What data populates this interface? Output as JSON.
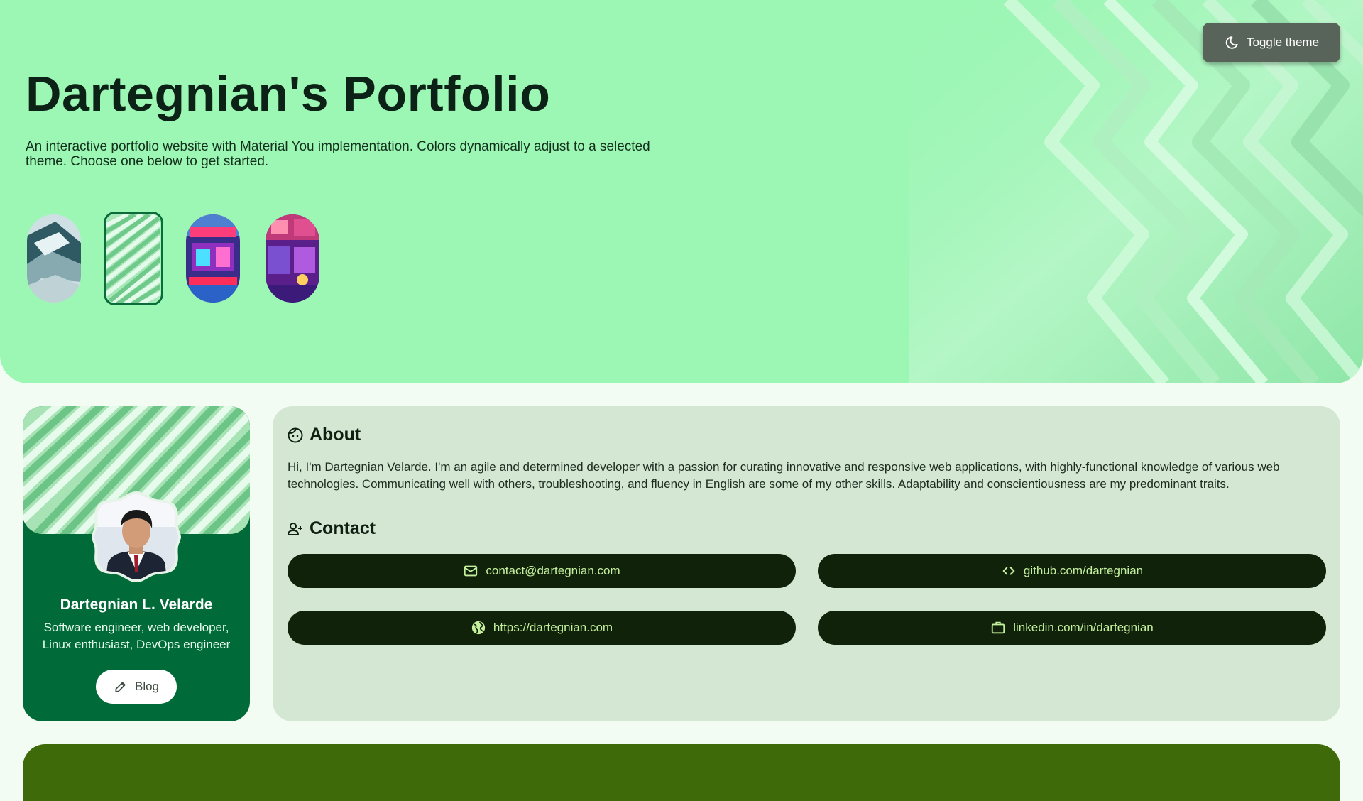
{
  "hero": {
    "title": "Dartegnian's Portfolio",
    "description": "An interactive portfolio website with Material You implementation. Colors dynamically adjust to a selected theme. Choose one below to get started.",
    "toggle_label": "Toggle theme",
    "themes": [
      {
        "name": "glass-blocks",
        "selected": false
      },
      {
        "name": "green-waves",
        "selected": true
      },
      {
        "name": "neon-street",
        "selected": false
      },
      {
        "name": "neon-arcade",
        "selected": false
      }
    ]
  },
  "profile": {
    "name": "Dartegnian L. Velarde",
    "role": "Software engineer, web developer, Linux enthusiast, DevOps engineer",
    "blog_label": "Blog"
  },
  "about": {
    "heading": "About",
    "text": "Hi, I'm Dartegnian Velarde. I'm an agile and determined developer with a passion for curating innovative and responsive web applications, with highly-functional knowledge of various web technologies. Communicating well with others, troubleshooting, and fluency in English are some of my other skills. Adaptability and conscientiousness are my predominant traits."
  },
  "contact": {
    "heading": "Contact",
    "email": "contact@dartegnian.com",
    "github": "github.com/dartegnian",
    "website": "https://dartegnian.com",
    "linkedin": "linkedin.com/in/dartegnian"
  },
  "colors": {
    "hero_bg": "#9cf6b4",
    "primary": "#006a39",
    "surface_variant": "#d3e7d3",
    "contact_bg": "#10220a",
    "contact_text": "#c5f09e",
    "bottom_bar": "#3f6a09"
  }
}
